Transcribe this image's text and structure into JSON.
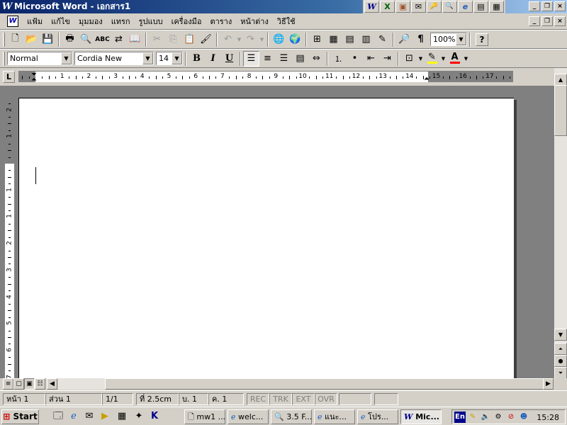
{
  "window": {
    "title": "Microsoft Word - เอกสาร1",
    "app_icon": "W",
    "title_icon_name": "word-app-icon"
  },
  "office_bar": {
    "icons": [
      "W",
      "X",
      "▣",
      "✉",
      "🔑",
      "🔍",
      "e",
      "▤",
      "▦"
    ]
  },
  "window_controls": {
    "minimize": "_",
    "restore": "❐",
    "close": "×"
  },
  "menu": {
    "items": [
      "แฟ้ม",
      "แก้ไข",
      "มุมมอง",
      "แทรก",
      "รูปแบบ",
      "เครื่องมือ",
      "ตาราง",
      "หน้าต่าง",
      "วิธีใช้"
    ]
  },
  "standard_toolbar": {
    "zoom": "100%",
    "help_label": "?"
  },
  "formatting_toolbar": {
    "style": "Normal",
    "font": "Cordia New",
    "font_size": "14",
    "bold_label": "B",
    "italic_label": "I",
    "underline_label": "U",
    "highlight_color": "#ffff00",
    "font_color": "#ff0000"
  },
  "ruler": {
    "tab_selector": "L",
    "h_numbers": [
      "1",
      "1",
      "2",
      "3",
      "4",
      "5",
      "6",
      "7",
      "8",
      "9",
      "10",
      "11",
      "12",
      "13",
      "14",
      "15",
      "16",
      "17"
    ],
    "v_numbers": [
      "2",
      "1",
      "1",
      "1",
      "2",
      "3",
      "4",
      "5",
      "6",
      "7"
    ]
  },
  "status_bar": {
    "page": "หน้า 1",
    "section": "ส่วน 1",
    "page_of": "1/1",
    "at": "ที่  2.5cm",
    "line": "บ.  1",
    "col": "ค.  1",
    "rec": "REC",
    "trk": "TRK",
    "ext": "EXT",
    "ovr": "OVR"
  },
  "taskbar": {
    "start_label": "Start",
    "tasks": [
      "mw1 ...",
      "welc...",
      "3.5 F...",
      "แนะ...",
      "โปร...",
      "Mic..."
    ],
    "language": "En",
    "clock": "15:28"
  }
}
